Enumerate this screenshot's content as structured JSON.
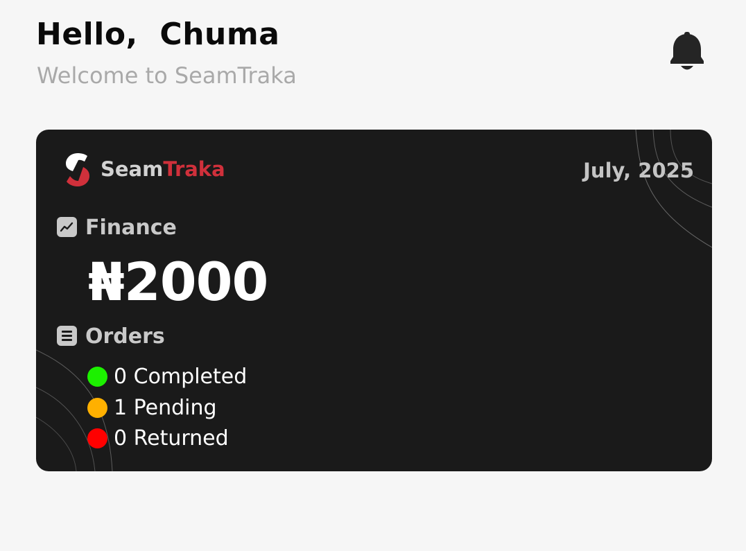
{
  "header": {
    "greeting": "Hello,  Chuma",
    "welcome": "Welcome to SeamTraka",
    "bell_icon": "bell-icon"
  },
  "card": {
    "brand_part1": "Seam",
    "brand_part2": "Traka",
    "logo_icon": "seamtraka-logo",
    "date": "July, 2025",
    "finance": {
      "label": "Finance",
      "icon": "trend-chart-icon",
      "amount": "₦2000"
    },
    "orders": {
      "label": "Orders",
      "icon": "list-icon",
      "items": [
        {
          "text": "0 Completed",
          "color": "#1cf000"
        },
        {
          "text": "1 Pending",
          "color": "#ffb000"
        },
        {
          "text": "0 Returned",
          "color": "#ff0000"
        }
      ]
    }
  },
  "colors": {
    "background": "#f6f6f6",
    "card": "#1a1a1a",
    "accent": "#d0303b"
  }
}
